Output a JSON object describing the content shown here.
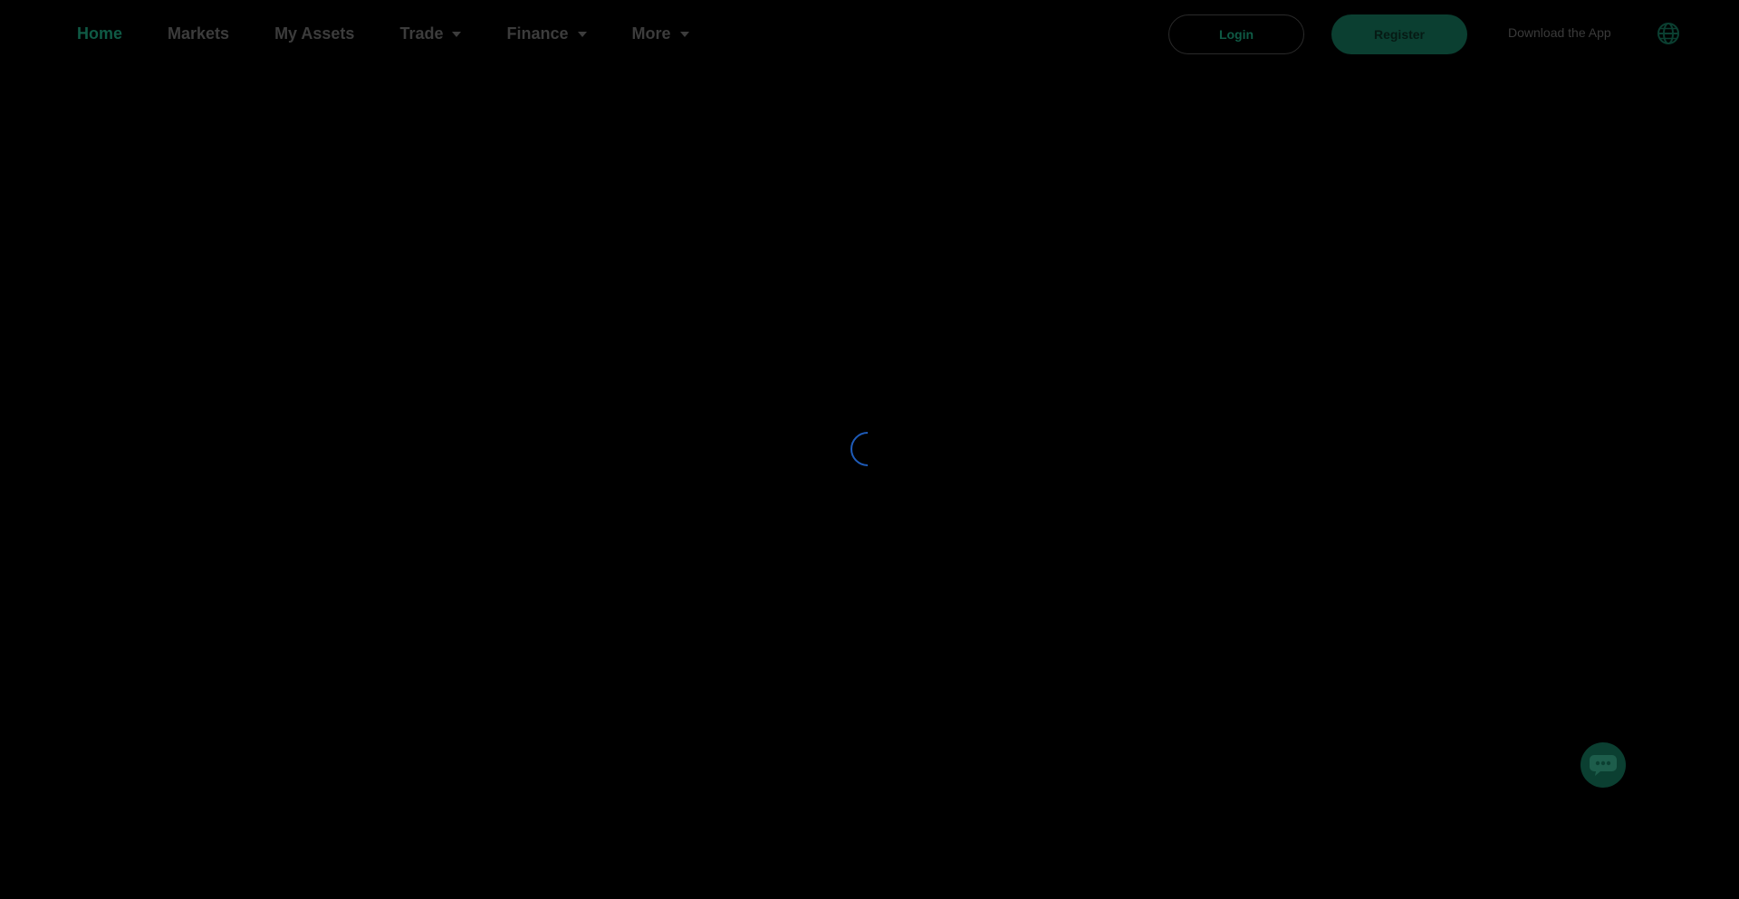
{
  "nav": {
    "items": [
      {
        "label": "Home",
        "active": true,
        "dropdown": false
      },
      {
        "label": "Markets",
        "active": false,
        "dropdown": false
      },
      {
        "label": "My Assets",
        "active": false,
        "dropdown": false
      },
      {
        "label": "Trade",
        "active": false,
        "dropdown": true
      },
      {
        "label": "Finance",
        "active": false,
        "dropdown": true
      },
      {
        "label": "More",
        "active": false,
        "dropdown": true
      }
    ]
  },
  "auth": {
    "login_label": "Login",
    "register_label": "Register"
  },
  "download_label": "Download the App",
  "icons": {
    "language": "globe-icon",
    "loading": "spinner-icon",
    "chat": "chat-bubble-icon"
  },
  "colors": {
    "background": "#000000",
    "accent": "#0f5a45",
    "accent_dark": "#0b3f31",
    "spinner": "#1e5bb8"
  }
}
